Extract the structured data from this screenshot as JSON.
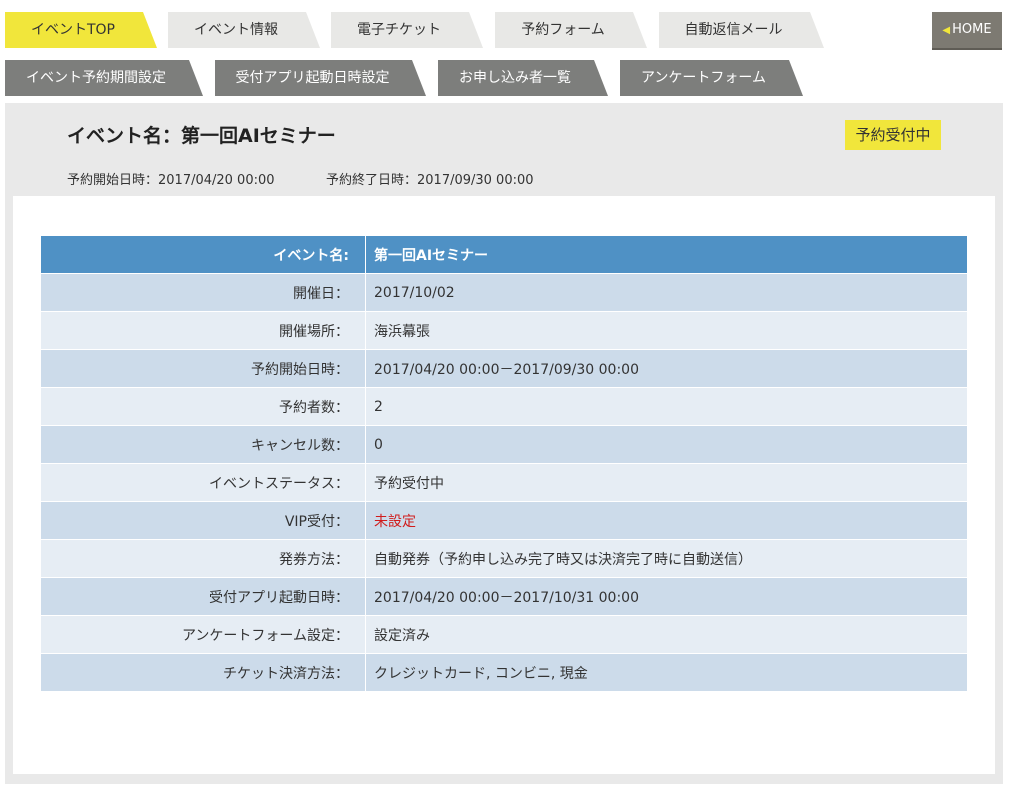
{
  "tabs_row1": [
    {
      "label": "イベントTOP",
      "active": true
    },
    {
      "label": "イベント情報"
    },
    {
      "label": "電子チケット"
    },
    {
      "label": "予約フォーム"
    },
    {
      "label": "自動返信メール"
    }
  ],
  "tabs_row2": [
    {
      "label": "イベント予約期間設定"
    },
    {
      "label": "受付アプリ起動日時設定"
    },
    {
      "label": "お申し込み者一覧"
    },
    {
      "label": "アンケートフォーム"
    }
  ],
  "home": {
    "arrow": "◀",
    "label": "HOME"
  },
  "event": {
    "title": "イベント名：第一回AIセミナー",
    "status_badge": "予約受付中",
    "start_date": "予約開始日時：2017/04/20 00:00",
    "end_date": "予約終了日時：2017/09/30 00:00"
  },
  "details": {
    "header": {
      "label": "イベント名:",
      "value": "第一回AIセミナー"
    },
    "rows": [
      {
        "label": "開催日：",
        "value": "2017/10/02"
      },
      {
        "label": "開催場所：",
        "value": "海浜幕張"
      },
      {
        "label": "予約開始日時：",
        "value": "2017/04/20 00:00－2017/09/30 00:00"
      },
      {
        "label": "予約者数：",
        "value": "2"
      },
      {
        "label": "キャンセル数：",
        "value": "0"
      },
      {
        "label": "イベントステータス：",
        "value": "予約受付中"
      },
      {
        "label": "VIP受付：",
        "value": "未設定"
      },
      {
        "label": "発券方法：",
        "value": "自動発券（予約申し込み完了時又は決済完了時に自動送信）"
      },
      {
        "label": "受付アプリ起動日時：",
        "value": "2017/04/20 00:00－2017/10/31 00:00"
      },
      {
        "label": "アンケートフォーム設定：",
        "value": "設定済み"
      },
      {
        "label": "チケット決済方法：",
        "value": "クレジットカード, コンビニ, 現金"
      }
    ]
  },
  "colors": {
    "accent_yellow": "#f1e63b",
    "header_blue": "#4f91c5",
    "warning_red": "#d01c1c"
  }
}
